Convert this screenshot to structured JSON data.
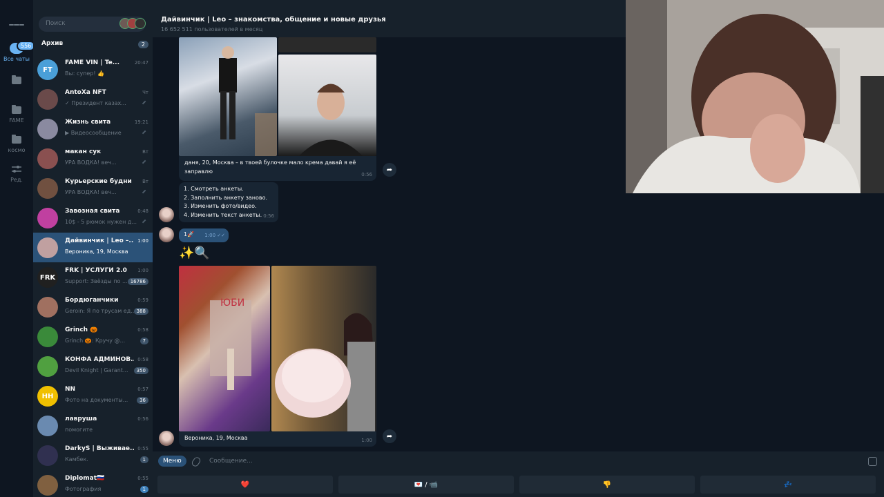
{
  "rail": {
    "items": [
      {
        "label": "Все чаты",
        "badge": "556"
      },
      {
        "label": ""
      },
      {
        "label": "FAME"
      },
      {
        "label": "космо"
      },
      {
        "label": "Ред."
      }
    ]
  },
  "search": {
    "placeholder": "Поиск"
  },
  "archive": {
    "label": "Архив",
    "count": "2"
  },
  "chats": [
    {
      "title": "FAME VIN | Te...",
      "time": "20:47",
      "preview": "Вы: супер! 👍",
      "avatar_text": "FT",
      "avatar_color": "#4a9fd8",
      "read": true
    },
    {
      "title": "AntoXa NFT",
      "time": "Чт",
      "preview": "✓ Президент казах...",
      "avatar_color": "#6a4a4a",
      "read": true,
      "pinned": true
    },
    {
      "title": "Жизнь свита",
      "time": "19:21",
      "preview": "▶ Видеосообщение",
      "avatar_color": "#8a8aa0",
      "read": true,
      "pinned": true
    },
    {
      "title": "макан сук",
      "time": "Вт",
      "preview": "УРА ВОДКА!  веч...",
      "avatar_color": "#8a5050",
      "read": true,
      "pinned": true
    },
    {
      "title": "Курьерские будни",
      "time": "Вт",
      "preview": "УРА ВОДКА!  веч...",
      "avatar_color": "#705040",
      "read": true,
      "pinned": true
    },
    {
      "title": "Завозная свита",
      "time": "0:48",
      "preview": "10$ - 5 рюмок  нужен д...",
      "avatar_color": "#c040a0",
      "read": true,
      "pinned": true
    },
    {
      "title": "Дайвинчик | Leo –...",
      "time": "1:00",
      "preview": "Вероника, 19, Москва",
      "avatar_color": "#c0a0a0",
      "selected": true
    },
    {
      "title": "FRK | УСЛУГИ 2.0",
      "time": "1:00",
      "preview": "Support: Звёзды по ...",
      "unread": "16786",
      "avatar_text": "FRK",
      "avatar_color": "#202020"
    },
    {
      "title": "Бордюганчики",
      "time": "0:59",
      "preview": "Geroin: Я по трусам ед...",
      "unread": "388",
      "avatar_color": "#a07060"
    },
    {
      "title": "Grinch 🎃",
      "time": "0:58",
      "preview": "Grinch 🎃: Кручу @...",
      "unread": "7",
      "avatar_color": "#3a8a3a"
    },
    {
      "title": "КОНФА АДМИНОВ...",
      "time": "0:58",
      "preview": "Devil Knight | Garant...",
      "unread": "350",
      "avatar_color": "#50a040"
    },
    {
      "title": "NN",
      "time": "0:57",
      "preview": "Фото на документы...",
      "unread": "36",
      "avatar_text": "HH",
      "avatar_color": "#f0c000"
    },
    {
      "title": "лавруша",
      "time": "0:56",
      "preview": "помогите",
      "avatar_color": "#6a8ab0"
    },
    {
      "title": "DarkyS | Выживае...",
      "time": "0:55",
      "preview": "Камбек.",
      "unread": "1",
      "avatar_color": "#303050"
    },
    {
      "title": "Diplomat🇷🇺",
      "time": "0:55",
      "preview": "Фотография",
      "unread": "1",
      "unread_blue": true,
      "avatar_color": "#806040"
    }
  ],
  "header": {
    "title": "Дайвинчик | Leo – знакомства, общение и новые друзья",
    "subtitle": "16 652 511 пользователей в месяц"
  },
  "messages": {
    "caption1": "даня, 20, Москва – в твоей булочке мало крема давай я её заправлю",
    "time1": "0:56",
    "menu_lines": [
      "1. Смотреть анкеты.",
      "2. Заполнить анкету заново.",
      "3. Изменить фото/видео.",
      "4. Изменить текст анкеты."
    ],
    "time2": "0:56",
    "own_text": "1🚀",
    "own_time": "1:00",
    "effect": "✨🔍",
    "caption2": "Вероника, 19, Москва",
    "time3": "1:00"
  },
  "composer": {
    "menu_label": "Меню",
    "placeholder": "Сообщение..."
  },
  "keyboard": {
    "keys": [
      "❤️",
      "💌 / 📹",
      "👎",
      "💤"
    ]
  }
}
